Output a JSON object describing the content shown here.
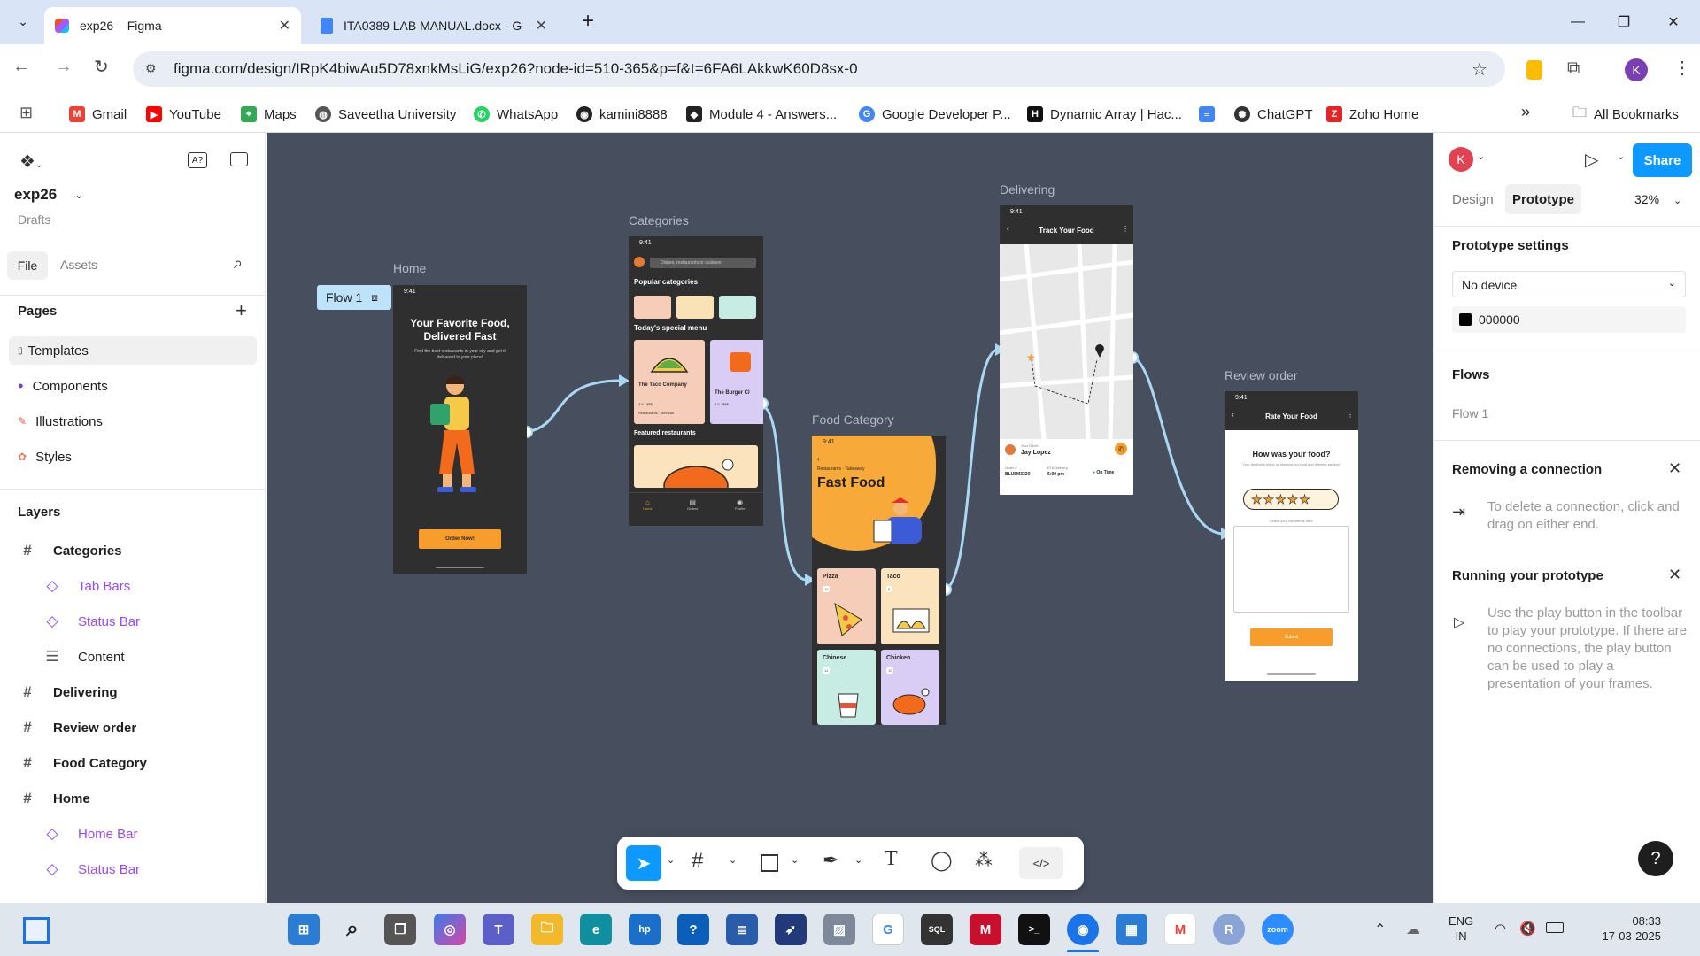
{
  "browser": {
    "tabs": [
      {
        "title": "exp26 – Figma",
        "active": true
      },
      {
        "title": "ITA0389 LAB MANUAL.docx - G",
        "active": false
      }
    ],
    "url": "figma.com/design/IRpK4biwAu5D78xnkMsLiG/exp26?node-id=510-365&p=f&t=6FA6LAkkwK60D8sx-0",
    "profile_initial": "K",
    "bookmarks": [
      "Gmail",
      "YouTube",
      "Maps",
      "Saveetha University",
      "WhatsApp",
      "kamini8888",
      "Module 4 - Answers...",
      "Google Developer P...",
      "Dynamic Array | Hac...",
      "",
      "ChatGPT",
      "Zoho Home"
    ],
    "all_bookmarks": "All Bookmarks",
    "colors": {
      "tabstrip": "#d9e5f7",
      "accent": "#0d99ff"
    }
  },
  "figma": {
    "file_name": "exp26",
    "location": "Drafts",
    "panel_tabs": [
      "File",
      "Assets"
    ],
    "pages_heading": "Pages",
    "pages": [
      {
        "label": "Templates",
        "active": true
      },
      {
        "label": "Components"
      },
      {
        "label": "Illustrations"
      },
      {
        "label": "Styles"
      }
    ],
    "layers_heading": "Layers",
    "layers": [
      {
        "label": "Categories",
        "type": "frame"
      },
      {
        "label": "Tab Bars",
        "type": "component"
      },
      {
        "label": "Status Bar",
        "type": "component"
      },
      {
        "label": "Content",
        "type": "text"
      },
      {
        "label": "Delivering",
        "type": "frame"
      },
      {
        "label": "Review order",
        "type": "frame"
      },
      {
        "label": "Food Category",
        "type": "frame"
      },
      {
        "label": "Home",
        "type": "frame"
      },
      {
        "label": "Home Bar",
        "type": "component"
      },
      {
        "label": "Status Bar",
        "type": "component"
      }
    ],
    "user_initial": "K",
    "share_label": "Share",
    "mode_tabs": [
      "Design",
      "Prototype"
    ],
    "zoom": "32%",
    "prototype_settings": "Prototype settings",
    "device": "No device",
    "bg_color": "000000",
    "flows_heading": "Flows",
    "flow": "Flow 1",
    "tip1_title": "Removing a connection",
    "tip1_text": "To delete a connection, click and drag on either end.",
    "tip2_title": "Running your prototype",
    "tip2_text": "Use the play button in the toolbar to play your prototype. If there are no connections, the play button can be used to play a presentation of your frames.",
    "help": "?"
  },
  "canvas": {
    "flow_badge": "Flow 1",
    "frames": {
      "home": {
        "label": "Home",
        "time": "9:41",
        "title": "Your Favorite Food, Delivered Fast",
        "subtitle": "Find the best restaurants in your city and get it delivered to your place!",
        "cta": "Order Now!"
      },
      "categories": {
        "label": "Categories",
        "time": "9:41",
        "search": "Dishes, restaurants or cuisines",
        "popular": "Popular categories",
        "special": "Today's special menu",
        "card1": "The Taco Company",
        "card1_rating": "4.8",
        "card1_price": "$$$",
        "card1_tags": "Restaurants",
        "card1_tag2": "Mexican",
        "card2": "The Burger Cl",
        "card2_rating": "5.0",
        "card2_price": "$$$",
        "featured": "Featured restaurants",
        "tabs": [
          "Home",
          "Orders",
          "Profile"
        ]
      },
      "food_category": {
        "label": "Food Category",
        "time": "9:41",
        "crumb1": "Restaurants",
        "crumb2": "Takeaway",
        "title": "Fast Food",
        "items": [
          {
            "name": "Pizza",
            "count": "10"
          },
          {
            "name": "Taco",
            "count": "8"
          },
          {
            "name": "Chinese",
            "count": "14"
          },
          {
            "name": "Chicken",
            "count": "10"
          }
        ]
      },
      "delivering": {
        "label": "Delivering",
        "time": "9:41",
        "title": "Track Your Food",
        "driver_label": "Your Driver",
        "driver": "Jay Lopez",
        "order_label": "Order #",
        "order": "BLU5M3320",
        "eta_label": "ETA Delivery",
        "eta": "6:00 pm",
        "status": "On Time"
      },
      "review": {
        "label": "Review order",
        "time": "9:41",
        "title": "Rate Your Food",
        "question": "How was your food?",
        "hint": "Your feedback helps us improve our food and delivery service!",
        "stars": 5,
        "comment_hint": "Leave your comments here",
        "submit": "Submit"
      }
    }
  },
  "taskbar": {
    "lang1": "ENG",
    "lang2": "IN",
    "time": "08:33",
    "date": "17-03-2025"
  }
}
